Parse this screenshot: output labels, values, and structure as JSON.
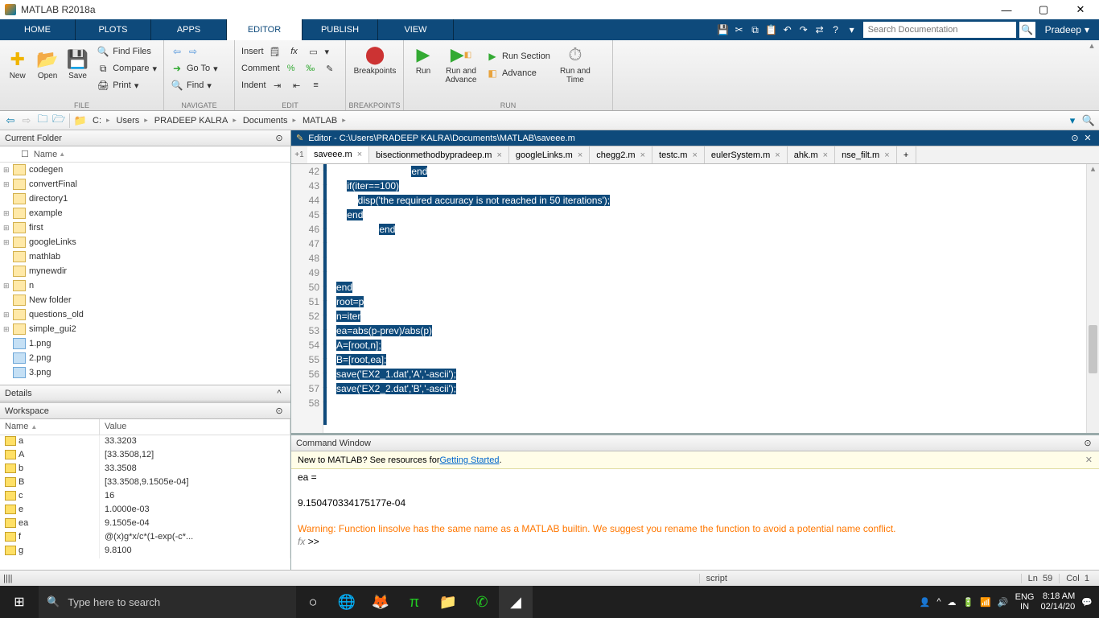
{
  "title": "MATLAB R2018a",
  "user": "Pradeep",
  "search_placeholder": "Search Documentation",
  "maintabs": [
    "HOME",
    "PLOTS",
    "APPS",
    "EDITOR",
    "PUBLISH",
    "VIEW"
  ],
  "active_maintab": 3,
  "toolbar": {
    "file": {
      "label": "FILE",
      "new": "New",
      "open": "Open",
      "save": "Save",
      "find_files": "Find Files",
      "compare": "Compare",
      "print": "Print"
    },
    "nav": {
      "label": "NAVIGATE",
      "goto": "Go To",
      "find": "Find"
    },
    "edit": {
      "label": "EDIT",
      "insert": "Insert",
      "comment": "Comment",
      "indent": "Indent"
    },
    "bp": {
      "label": "BREAKPOINTS",
      "breakpoints": "Breakpoints"
    },
    "run": {
      "label": "RUN",
      "run": "Run",
      "run_advance": "Run and\nAdvance",
      "run_section": "Run Section",
      "advance": "Advance",
      "run_time": "Run and\nTime"
    }
  },
  "breadcrumbs": [
    "C:",
    "Users",
    "PRADEEP KALRA",
    "Documents",
    "MATLAB"
  ],
  "current_folder": {
    "title": "Current Folder",
    "header": "Name",
    "items": [
      {
        "name": "codegen",
        "type": "folder",
        "exp": true
      },
      {
        "name": "convertFinal",
        "type": "folder",
        "exp": true
      },
      {
        "name": "directory1",
        "type": "folder",
        "exp": false
      },
      {
        "name": "example",
        "type": "folder",
        "exp": true
      },
      {
        "name": "first",
        "type": "folder",
        "exp": true
      },
      {
        "name": "googleLinks",
        "type": "folder",
        "exp": true
      },
      {
        "name": "mathlab",
        "type": "folder",
        "exp": false
      },
      {
        "name": "mynewdir",
        "type": "folder",
        "exp": false
      },
      {
        "name": "n",
        "type": "folder",
        "exp": true
      },
      {
        "name": "New folder",
        "type": "folder",
        "exp": false
      },
      {
        "name": "questions_old",
        "type": "folder",
        "exp": true
      },
      {
        "name": "simple_gui2",
        "type": "folder",
        "exp": true
      },
      {
        "name": "1.png",
        "type": "img",
        "exp": false
      },
      {
        "name": "2.png",
        "type": "img",
        "exp": false
      },
      {
        "name": "3.png",
        "type": "img",
        "exp": false
      }
    ]
  },
  "details_title": "Details",
  "workspace": {
    "title": "Workspace",
    "headers": [
      "Name",
      "Value"
    ],
    "vars": [
      {
        "name": "a",
        "value": "33.3203"
      },
      {
        "name": "A",
        "value": "[33.3508,12]"
      },
      {
        "name": "b",
        "value": "33.3508"
      },
      {
        "name": "B",
        "value": "[33.3508,9.1505e-04]"
      },
      {
        "name": "c",
        "value": "16"
      },
      {
        "name": "e",
        "value": "1.0000e-03"
      },
      {
        "name": "ea",
        "value": "9.1505e-04"
      },
      {
        "name": "f",
        "value": "@(x)g*x/c*(1-exp(-c*..."
      },
      {
        "name": "g",
        "value": "9.8100"
      }
    ]
  },
  "editor": {
    "title": "Editor - C:\\Users\\PRADEEP KALRA\\Documents\\MATLAB\\saveee.m",
    "tabs": [
      "saveee.m",
      "bisectionmethodbypradeep.m",
      "googleLinks.m",
      "chegg2.m",
      "testc.m",
      "eulerSystem.m",
      "ahk.m",
      "nse_filt.m"
    ],
    "active_tab": 0,
    "shift": "+1",
    "first_line": 42,
    "lines": [
      {
        "indent": 28,
        "text": "end",
        "sel": true
      },
      {
        "indent": 4,
        "text": "if(iter==100)",
        "sel": true
      },
      {
        "indent": 8,
        "text": "disp('the required accuracy is not reached in 50 iterations');",
        "sel": true
      },
      {
        "indent": 4,
        "text": "end",
        "sel": true
      },
      {
        "indent": 16,
        "text": "end",
        "sel": true
      },
      {
        "indent": 0,
        "text": "",
        "sel": false
      },
      {
        "indent": 0,
        "text": "",
        "sel": false
      },
      {
        "indent": 0,
        "text": "",
        "sel": false
      },
      {
        "indent": 0,
        "text": "end",
        "sel": true
      },
      {
        "indent": 0,
        "text": "root=p",
        "sel": true
      },
      {
        "indent": 0,
        "text": "n=iter",
        "sel": true
      },
      {
        "indent": 0,
        "text": "ea=abs(p-prev)/abs(p)",
        "sel": true
      },
      {
        "indent": 0,
        "text": "A=[root,n];",
        "sel": true
      },
      {
        "indent": 0,
        "text": "B=[root,ea];",
        "sel": true
      },
      {
        "indent": 0,
        "text": "save('EX2_1.dat','A','-ascii');",
        "sel": true
      },
      {
        "indent": 0,
        "text": "save('EX2_2.dat','B','-ascii');",
        "sel": true
      },
      {
        "indent": 0,
        "text": "",
        "sel": false
      }
    ]
  },
  "cmdwin": {
    "title": "Command Window",
    "banner_pre": "New to MATLAB? See resources for ",
    "banner_link": "Getting Started",
    "banner_post": ".",
    "out1": "ea =",
    "out2": "    9.150470334175177e-04",
    "warn": "Warning: Function linsolve has the same name as a MATLAB builtin. We suggest you rename the function to avoid a potential name conflict.",
    "prompt": ">>"
  },
  "status": {
    "left": "||||",
    "type": "script",
    "ln": "Ln",
    "ln_val": "59",
    "col": "Col",
    "col_val": "1"
  },
  "taskbar": {
    "search": "Type here to search",
    "lang1": "ENG",
    "lang2": "IN",
    "time": "8:18 AM",
    "date": "02/14/20"
  }
}
